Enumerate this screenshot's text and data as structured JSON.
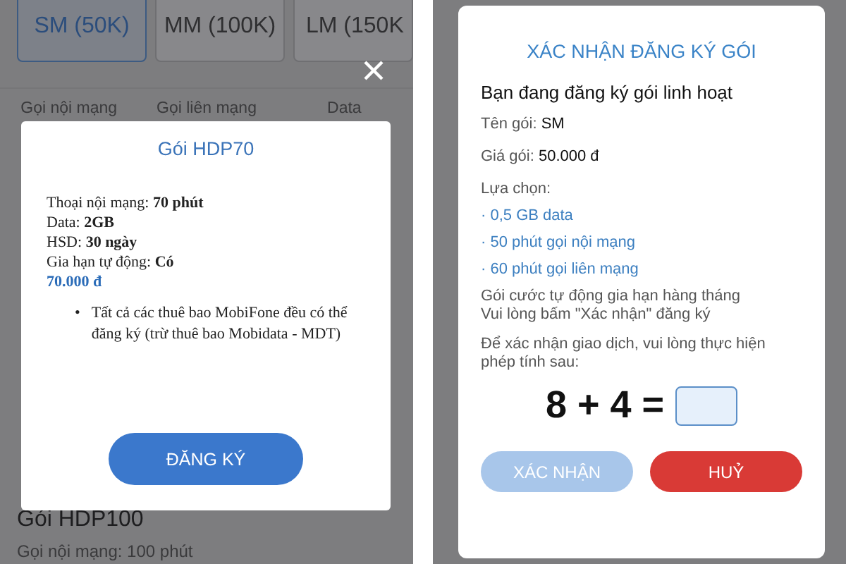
{
  "left_screen": {
    "package_tabs": [
      {
        "label": "SM (50K)",
        "selected": true
      },
      {
        "label": "MM (100K)",
        "selected": false
      },
      {
        "label": "LM (150K",
        "selected": false
      }
    ],
    "columns": [
      "Gọi nội mạng",
      "Gọi liên mạng",
      "Data"
    ],
    "next_package": {
      "name": "Gói HDP100",
      "detail": "Gọi nội mạng: 100 phút"
    },
    "dialog": {
      "title": "Gói HDP70",
      "details": [
        {
          "label": "Thoại nội mạng:",
          "value": "70 phút"
        },
        {
          "label": "Data:",
          "value": "2GB"
        },
        {
          "label": "HSD:",
          "value": "30 ngày"
        },
        {
          "label": "Gia hạn tự động:",
          "value": "Có"
        }
      ],
      "price": "70.000 đ",
      "notes": [
        {
          "bullet": "•",
          "text": "Tất cả các thuê bao MobiFone đều có thể đăng ký (trừ thuê bao Mobidata - MDT)"
        }
      ],
      "button": "ĐĂNG KÝ"
    }
  },
  "right_screen": {
    "dialog": {
      "title": "XÁC NHẬN ĐĂNG KÝ GÓI",
      "heading": "Bạn đang đăng ký gói linh hoạt",
      "fields": [
        {
          "label": "Tên gói:",
          "value": "SM"
        },
        {
          "label": "Giá gói:",
          "value": "50.000 đ"
        }
      ],
      "options_label": "Lựa chọn:",
      "options": [
        "· 0,5 GB data",
        "· 50 phút gọi nội mạng",
        "· 60 phút gọi liên mạng"
      ],
      "notes": [
        "Gói cước tự động gia hạn hàng tháng",
        "Vui lòng bấm \"Xác nhận\" đăng ký"
      ],
      "instruction": "Để xác nhận giao dịch, vui lòng thực hiện phép tính sau:",
      "captcha": {
        "expression": "8 + 4 ="
      },
      "buttons": [
        {
          "label": "XÁC NHẬN",
          "kind": "confirm",
          "disabled": true
        },
        {
          "label": "HUỶ",
          "kind": "cancel",
          "disabled": false
        }
      ]
    }
  }
}
